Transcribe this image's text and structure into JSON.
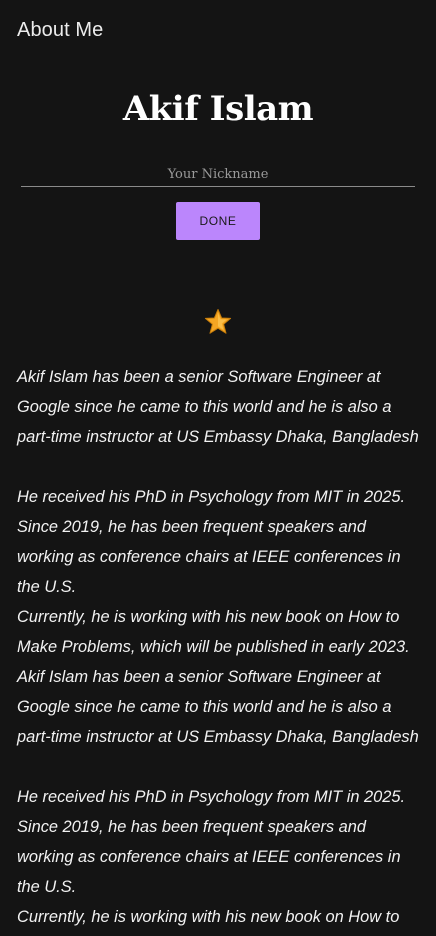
{
  "app_bar": {
    "title": "About Me"
  },
  "profile": {
    "name": "Akif Islam",
    "nickname_placeholder": "Your Nickname",
    "nickname_value": "",
    "done_label": "DONE",
    "star_icon": "star-icon"
  },
  "colors": {
    "background": "#141414",
    "accent": "#bb86fc",
    "star": "#f5a623"
  },
  "bio": {
    "text": "Akif Islam has been a senior Software Engineer at\nGoogle since he came to this world and he is also a\npart-time instructor at US Embassy Dhaka, Bangladesh\n\nHe received his PhD in Psychology from MIT in 2025.\nSince 2019, he has been frequent speakers and\nworking as conference chairs at IEEE conferences in\nthe U.S.\nCurrently, he is working with his new book on How to\nMake Problems, which will be published in early 2023.\nAkif Islam has been a senior Software Engineer at\nGoogle since he came to this world and he is also a\npart-time instructor at US Embassy Dhaka, Bangladesh\n\nHe received his PhD in Psychology from MIT in 2025.\nSince 2019, he has been frequent speakers and\nworking as conference chairs at IEEE conferences in\nthe U.S.\nCurrently, he is working with his new book on How to"
  }
}
